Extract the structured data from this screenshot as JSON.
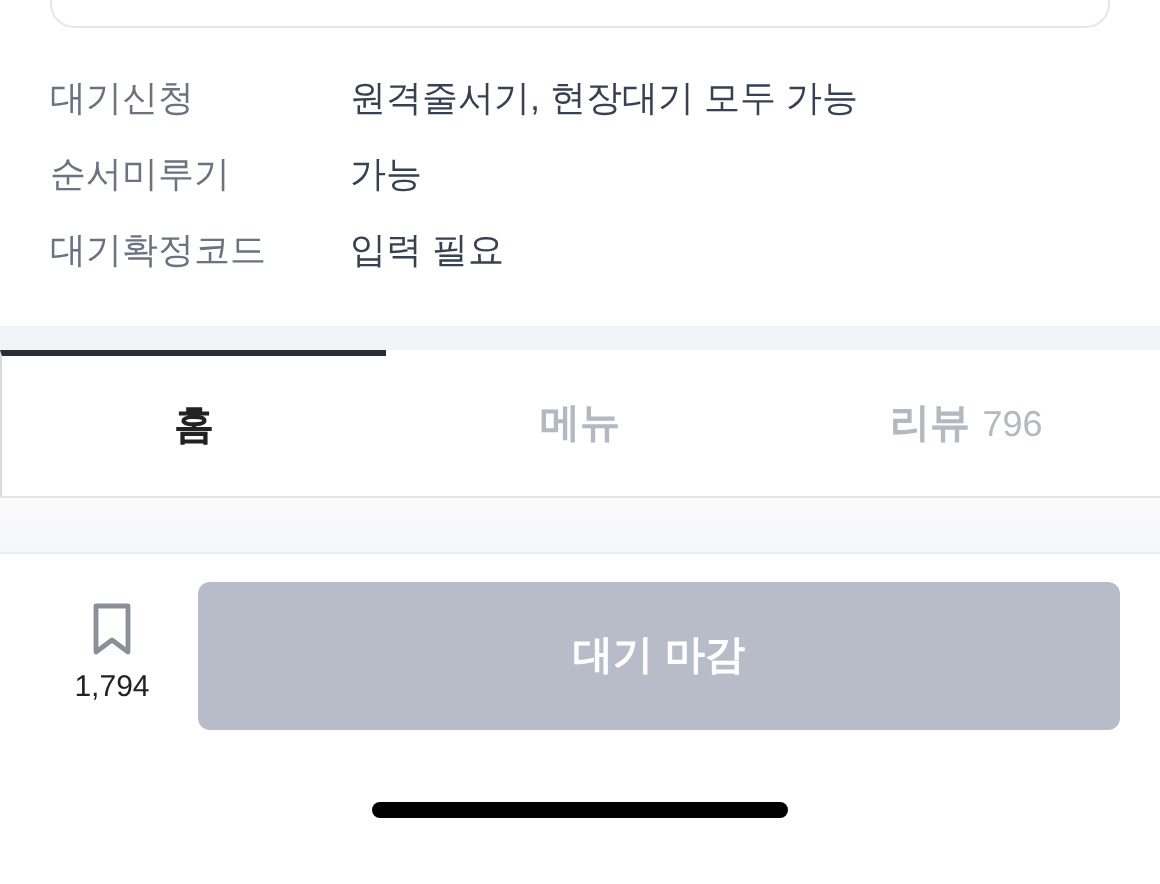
{
  "info_rows": [
    {
      "label": "대기신청",
      "value": "원격줄서기, 현장대기 모두 가능"
    },
    {
      "label": "순서미루기",
      "value": "가능"
    },
    {
      "label": "대기확정코드",
      "value": "입력 필요"
    }
  ],
  "tabs": [
    {
      "label": "홈",
      "selected": true
    },
    {
      "label": "메뉴",
      "selected": false
    },
    {
      "label": "리뷰",
      "count": "796",
      "selected": false
    }
  ],
  "bottom_bar": {
    "bookmark_count": "1,794",
    "wait_button": {
      "label": "대기 마감",
      "disabled": true
    }
  }
}
